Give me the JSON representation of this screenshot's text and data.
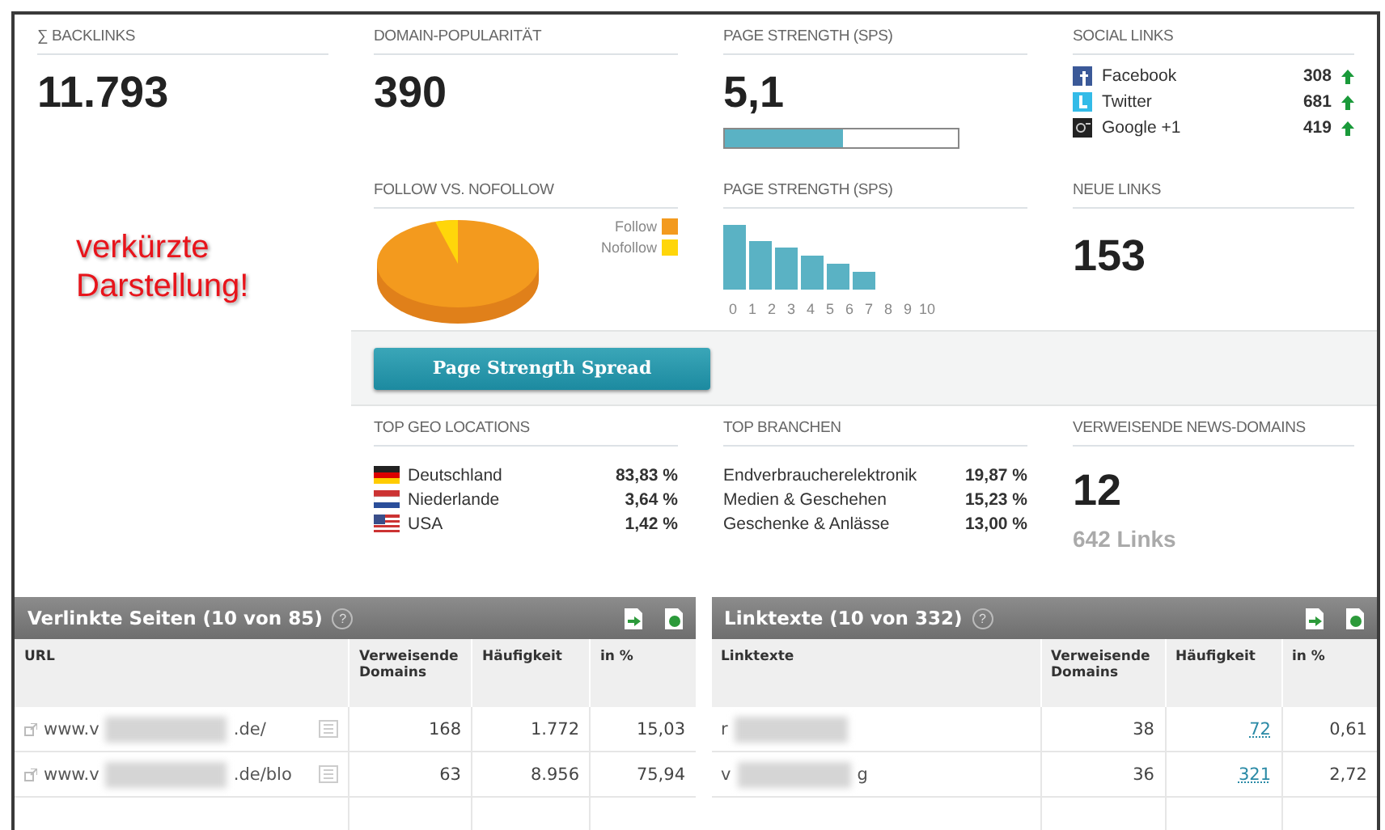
{
  "backlinks": {
    "label": "∑ BACKLINKS",
    "value": "11.793"
  },
  "annotation": [
    "verkürzte",
    "Darstellung!"
  ],
  "domain_popularity": {
    "label": "DOMAIN-POPULARITÄT",
    "value": "390"
  },
  "page_strength": {
    "label": "PAGE STRENGTH (SPS)",
    "value": "5,1",
    "level": 0.51
  },
  "social_links": {
    "label": "SOCIAL LINKS",
    "items": [
      {
        "kind": "facebook",
        "name": "Facebook",
        "count": "308"
      },
      {
        "kind": "twitter",
        "name": "Twitter",
        "count": "681"
      },
      {
        "kind": "google",
        "name": "Google +1",
        "count": "419"
      }
    ]
  },
  "follow_vs_nofollow": {
    "label": "FOLLOW VS. NOFOLLOW",
    "legend": [
      {
        "name": "Follow",
        "color": "#f39a1e"
      },
      {
        "name": "Nofollow",
        "color": "#ffd60a"
      }
    ]
  },
  "sps_distribution": {
    "label": "PAGE STRENGTH (SPS)",
    "x_labels": [
      "0",
      "1",
      "2",
      "3",
      "4",
      "5",
      "6",
      "7",
      "8",
      "9",
      "10"
    ]
  },
  "new_links": {
    "label": "NEUE LINKS",
    "value": "153"
  },
  "spread_button": "Page Strength Spread",
  "top_geo": {
    "label": "TOP GEO LOCATIONS",
    "items": [
      {
        "kind": "de",
        "name": "Deutschland",
        "share": "83,83 %"
      },
      {
        "kind": "nl",
        "name": "Niederlande",
        "share": "3,64 %"
      },
      {
        "kind": "us",
        "name": "USA",
        "share": "1,42 %"
      }
    ]
  },
  "top_branchen": {
    "label": "TOP BRANCHEN",
    "items": [
      {
        "name": "Endverbraucherelektronik",
        "share": "19,87 %"
      },
      {
        "name": "Medien & Geschehen",
        "share": "15,23 %"
      },
      {
        "name": "Geschenke & Anlässe",
        "share": "13,00 %"
      }
    ]
  },
  "news_domains": {
    "label": "VERWEISENDE NEWS-DOMAINS",
    "value": "12",
    "links": "642 Links"
  },
  "tables": [
    {
      "kind": "pages",
      "title": "Verlinkte Seiten (10 von 85)",
      "help": "?",
      "columns": [
        "URL",
        "Verweisende Domains",
        "Häufigkeit",
        "in %"
      ],
      "rows": [
        {
          "text_start": "www.v",
          "text_end": ".de/",
          "domains": "168",
          "frequency": "1.772",
          "percent": "15,03"
        },
        {
          "text_start": "www.v",
          "text_end": ".de/blo",
          "domains": "63",
          "frequency": "8.956",
          "percent": "75,94"
        }
      ]
    },
    {
      "kind": "linktexts",
      "title": "Linktexte (10 von 332)",
      "help": "?",
      "columns": [
        "Linktexte",
        "Verweisende Domains",
        "Häufigkeit",
        "in %"
      ],
      "rows": [
        {
          "text_start": "r",
          "domains": "38",
          "frequency": "72",
          "percent": "0,61"
        },
        {
          "text_start": "v",
          "text_end": "g",
          "domains": "36",
          "frequency": "321",
          "percent": "2,72"
        }
      ]
    }
  ]
}
